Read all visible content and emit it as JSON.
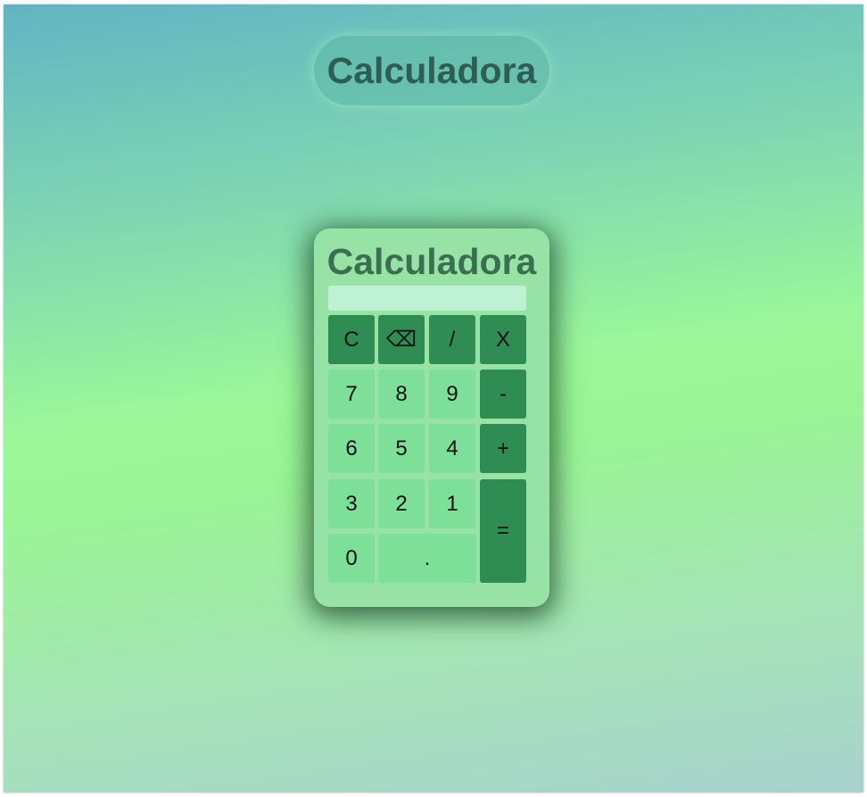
{
  "header": {
    "title": "Calculadora"
  },
  "calculator": {
    "title": "Calculadora",
    "display_value": "",
    "keys": {
      "clear": "C",
      "backspace": "⌫",
      "divide": "/",
      "multiply": "X",
      "seven": "7",
      "eight": "8",
      "nine": "9",
      "minus": "-",
      "six": "6",
      "five": "5",
      "four": "4",
      "plus": "+",
      "three": "3",
      "two": "2",
      "one": "1",
      "equals": "=",
      "zero": "0",
      "decimal": "."
    }
  },
  "colors": {
    "number_key": "#7ddf98",
    "operator_key": "#2f8c52",
    "calculator_body": "#96e3a5",
    "display": "#bff1d4"
  }
}
